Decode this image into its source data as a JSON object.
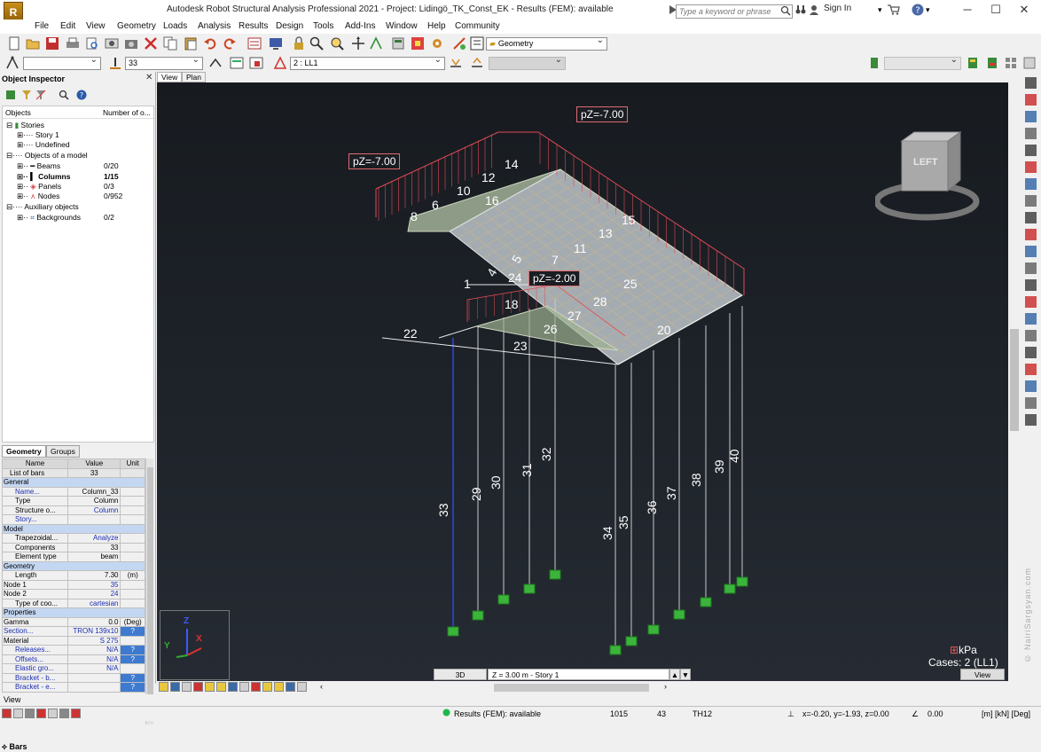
{
  "window": {
    "title": "Autodesk Robot Structural Analysis Professional 2021 - Project: Lidingö_TK_Const_EK - Results (FEM): available",
    "app_logo_text": "R",
    "search_placeholder": "Type a keyword or phrase",
    "sign_in": "Sign In",
    "minimize": "─",
    "maximize": "☐",
    "close": "✕"
  },
  "menu": [
    "File",
    "Edit",
    "View",
    "Geometry",
    "Loads",
    "Analysis",
    "Results",
    "Design",
    "Tools",
    "Add-Ins",
    "Window",
    "Help",
    "Community"
  ],
  "toolbar1": {
    "layout_combo": "Geometry"
  },
  "toolbar2": {
    "bar_number": "33",
    "load_case": "2 : LL1"
  },
  "object_inspector": {
    "title": "Object Inspector",
    "close": "✕",
    "col_objects": "Objects",
    "col_number": "Number of o...",
    "tree": [
      {
        "label": "Stories",
        "value": ""
      },
      {
        "label": "Story 1",
        "value": ""
      },
      {
        "label": "Undefined",
        "value": ""
      },
      {
        "label": "Objects of a model",
        "value": ""
      },
      {
        "label": "Beams",
        "value": "0/20"
      },
      {
        "label": "Columns",
        "value": "1/15"
      },
      {
        "label": "Panels",
        "value": "0/3"
      },
      {
        "label": "Nodes",
        "value": "0/952"
      },
      {
        "label": "Auxiliary objects",
        "value": ""
      },
      {
        "label": "Backgrounds",
        "value": "0/2"
      }
    ],
    "tabs": [
      "Geometry",
      "Groups"
    ],
    "bottom_tab": "Bars",
    "table_header": {
      "name": "Name",
      "value": "Value",
      "unit": "Unit"
    },
    "rows": [
      {
        "type": "row",
        "name": "List of bars",
        "value": "33",
        "unit": ""
      },
      {
        "type": "section",
        "name": "General"
      },
      {
        "type": "row",
        "name": "Name...",
        "value": "Column_33",
        "unit": "",
        "blue": true
      },
      {
        "type": "row",
        "name": "Type",
        "value": "Column",
        "unit": ""
      },
      {
        "type": "row",
        "name": "Structure o...",
        "value": "Column",
        "unit": "",
        "bluev": true
      },
      {
        "type": "row",
        "name": "Story...",
        "value": "",
        "unit": "",
        "blue": true
      },
      {
        "type": "section",
        "name": "Model"
      },
      {
        "type": "row",
        "name": "Trapezoidal...",
        "value": "Analyze",
        "unit": "",
        "bluev": true
      },
      {
        "type": "row",
        "name": "Components",
        "value": "33",
        "unit": ""
      },
      {
        "type": "row",
        "name": "Element type",
        "value": "beam",
        "unit": ""
      },
      {
        "type": "section",
        "name": "Geometry"
      },
      {
        "type": "row",
        "name": "Length",
        "value": "7.30",
        "unit": "(m)"
      },
      {
        "type": "row",
        "name": "Node 1",
        "value": "35",
        "unit": "",
        "bluev": true,
        "plus": true
      },
      {
        "type": "row",
        "name": "Node 2",
        "value": "24",
        "unit": "",
        "bluev": true,
        "plus": true
      },
      {
        "type": "row",
        "name": "Type of coo...",
        "value": "cartesian",
        "unit": "",
        "bluev": true
      },
      {
        "type": "section",
        "name": "Properties"
      },
      {
        "type": "row",
        "name": "Gamma",
        "value": "0.0",
        "unit": "(Deg)",
        "plus": true
      },
      {
        "type": "row",
        "name": "Section...",
        "value": "TRON 139x10",
        "unit": "?",
        "blue": true,
        "bluev": true,
        "plus": true
      },
      {
        "type": "row",
        "name": "Material",
        "value": "S 275",
        "unit": "",
        "bluev": true,
        "plus": true
      },
      {
        "type": "row",
        "name": "Releases...",
        "value": "N/A",
        "unit": "?",
        "blue": true,
        "bluev": true
      },
      {
        "type": "row",
        "name": "Offsets...",
        "value": "N/A",
        "unit": "?",
        "blue": true,
        "bluev": true
      },
      {
        "type": "row",
        "name": "Elastic gro...",
        "value": "N/A",
        "unit": "",
        "blue": true,
        "bluev": true
      },
      {
        "type": "row",
        "name": "Bracket - b...",
        "value": "",
        "unit": "?",
        "blue": true
      },
      {
        "type": "row",
        "name": "Bracket - e...",
        "value": "",
        "unit": "?",
        "blue": true
      }
    ]
  },
  "view_tabs": [
    "View",
    "Plan"
  ],
  "viewport": {
    "load_labels": [
      "pZ=-7.00",
      "pZ=-7.00",
      "pZ=-2.00"
    ],
    "units_label": "kPa",
    "cases_label": "Cases: 2 (LL1)",
    "viewcube_face": "LEFT",
    "member_numbers": [
      "1",
      "4",
      "5",
      "6",
      "7",
      "8",
      "10",
      "11",
      "12",
      "13",
      "14",
      "15",
      "16",
      "18",
      "20",
      "22",
      "23",
      "24",
      "25",
      "26",
      "27",
      "28",
      "29",
      "30",
      "31",
      "32",
      "33",
      "34",
      "35",
      "36",
      "37",
      "38",
      "39",
      "40"
    ],
    "axes": {
      "x": "X",
      "y": "Y",
      "z": "Z"
    }
  },
  "view_footer": {
    "mode_3d": "3D",
    "level": "Z = 3.00 m - Story 1",
    "view_btn": "View"
  },
  "bottom_bar_label": "View",
  "status": {
    "results": "Results (FEM): available",
    "nodes": "1015",
    "bars": "43",
    "section": "TH12",
    "coords": "x=-0.20, y=-1.93, z=0.00",
    "angle": "0.00",
    "units": "[m] [kN] [Deg]"
  },
  "watermark": "© NairiSargsyan.com",
  "colors": {
    "selected_blue": "#2f44d8",
    "support_green": "#3cb43c",
    "load_red": "#e04a55",
    "panel_fill": "#c8d0d4"
  }
}
